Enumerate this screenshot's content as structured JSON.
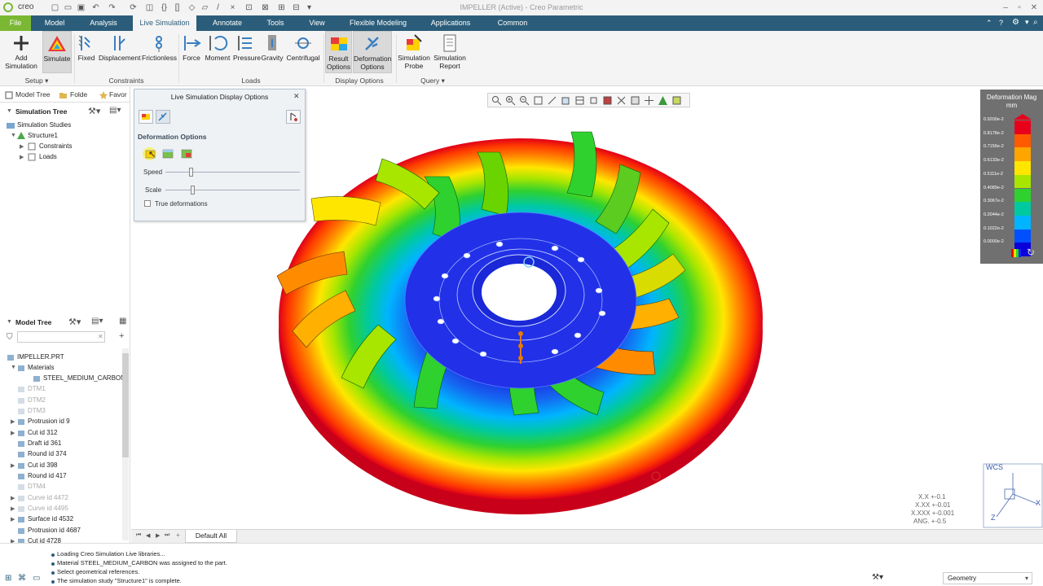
{
  "window": {
    "app_name": "creo",
    "title": "IMPELLER (Active) - Creo Parametric"
  },
  "tabs": [
    "File",
    "Model",
    "Analysis",
    "Live Simulation",
    "Annotate",
    "Tools",
    "View",
    "Flexible Modeling",
    "Applications",
    "Common"
  ],
  "ribbon": {
    "setup": {
      "label": "Setup",
      "buttons": [
        "Add\nSimulation",
        "Simulate"
      ],
      "add_sim_line1": "Add",
      "add_sim_line2": "Simulation",
      "simulate": "Simulate"
    },
    "constraints": {
      "label": "Constraints",
      "fixed": "Fixed",
      "displacement": "Displacement",
      "frictionless": "Frictionless"
    },
    "loads": {
      "label": "Loads",
      "force": "Force",
      "moment": "Moment",
      "pressure": "Pressure",
      "gravity": "Gravity",
      "centrifugal": "Centrifugal"
    },
    "display": {
      "label": "Display Options",
      "result_l1": "Result",
      "result_l2": "Options",
      "deform_l1": "Deformation",
      "deform_l2": "Options"
    },
    "query": {
      "label": "Query",
      "probe_l1": "Simulation",
      "probe_l2": "Probe",
      "report_l1": "Simulation",
      "report_l2": "Report"
    }
  },
  "panel_tabs": {
    "model_tree": "Model Tree",
    "folder": "Folde",
    "favorites": "Favor"
  },
  "simulation_tree": {
    "title": "Simulation Tree",
    "studies": "Simulation Studies",
    "structure": "Structure1",
    "constraints": "Constraints",
    "loads": "Loads"
  },
  "model_tree": {
    "title": "Model Tree",
    "search_placeholder": "",
    "items": [
      {
        "label": "IMPELLER.PRT",
        "dim": false
      },
      {
        "label": "Materials",
        "dim": false
      },
      {
        "label": "STEEL_MEDIUM_CARBON",
        "dim": false
      },
      {
        "label": "DTM1",
        "dim": true
      },
      {
        "label": "DTM2",
        "dim": true
      },
      {
        "label": "DTM3",
        "dim": true
      },
      {
        "label": "Protrusion id 9",
        "dim": false
      },
      {
        "label": "Cut id 312",
        "dim": false
      },
      {
        "label": "Draft id 361",
        "dim": false
      },
      {
        "label": "Round id 374",
        "dim": false
      },
      {
        "label": "Cut id 398",
        "dim": false
      },
      {
        "label": "Round id 417",
        "dim": false
      },
      {
        "label": "DTM4",
        "dim": true
      },
      {
        "label": "Curve id 4472",
        "dim": true
      },
      {
        "label": "Curve id 4495",
        "dim": true
      },
      {
        "label": "Surface id 4532",
        "dim": false
      },
      {
        "label": "Protrusion id 4687",
        "dim": false
      },
      {
        "label": "Cut id 4728",
        "dim": false
      }
    ]
  },
  "dialog": {
    "title": "Live Simulation Display Options",
    "section": "Deformation Options",
    "speed_label": "Speed",
    "speed_value": 0.17,
    "scale_label": "Scale",
    "scale_value": 0.18,
    "true_deformations": "True deformations",
    "true_deformations_checked": false
  },
  "legend": {
    "title_line1": "Deformation Mag",
    "title_line2": "mm",
    "values": [
      "0.9200e-2",
      "0.8178e-2",
      "0.7156e-2",
      "0.6133e-2",
      "0.5111e-2",
      "0.4089e-2",
      "0.3067e-2",
      "0.2044e-2",
      "0.1022e-2",
      "0.0000e-2"
    ],
    "colors": [
      "#e8001b",
      "#ff5a00",
      "#ffa500",
      "#ffe600",
      "#a8e600",
      "#2fd12f",
      "#00c9a0",
      "#00b4ff",
      "#0050ff",
      "#0a00d9"
    ]
  },
  "graphics_tabs": {
    "default_all": "Default All"
  },
  "csys": {
    "label": "WCS",
    "x": "X",
    "z": "Z",
    "precision": [
      "X.X +-0.1",
      "X.XX +-0.01",
      "X.XXX +-0.001",
      "ANG. +-0.5"
    ]
  },
  "status": {
    "messages": [
      "Loading Creo Simulation Live libraries...",
      "Material STEEL_MEDIUM_CARBON was assigned to the part.",
      "Select geometrical references.",
      "The simulation study \"Structure1\" is complete."
    ],
    "filter": "Geometry"
  }
}
